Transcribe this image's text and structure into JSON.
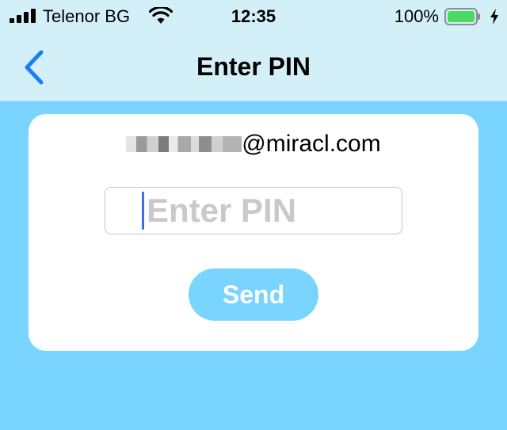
{
  "status_bar": {
    "carrier": "Telenor BG",
    "time": "12:35",
    "battery_percent": "100%",
    "battery_level": 1.0,
    "signal_bars": 4,
    "icons": [
      "signal-icon",
      "wifi-icon",
      "battery-icon",
      "charging-bolt-icon"
    ]
  },
  "nav": {
    "title": "Enter PIN",
    "back_icon": "chevron-left-icon"
  },
  "card": {
    "email_domain": "@miracl.com",
    "pin_placeholder": "Enter PIN",
    "pin_value": "",
    "send_label": "Send"
  },
  "colors": {
    "background": "#79d4ff",
    "nav_background": "#d3f0f8",
    "accent": "#1a7ff5",
    "button": "#79d4ff",
    "battery_green": "#4cd964"
  }
}
